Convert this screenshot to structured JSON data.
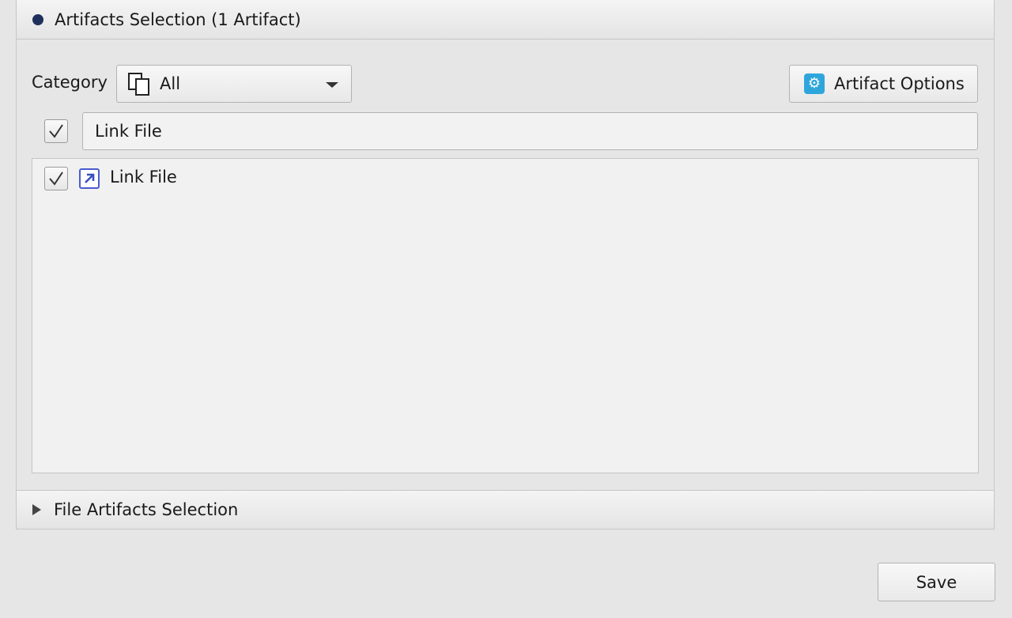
{
  "artifacts_section": {
    "title": "Artifacts Selection (1 Artifact)",
    "expanded": true,
    "category": {
      "label": "Category",
      "selected": "All",
      "icon": "copy-icon"
    },
    "options_button": {
      "label": "Artifact Options",
      "icon": "gear-icon"
    },
    "filter": {
      "checked": true,
      "value": "Link File"
    },
    "items": [
      {
        "label": "Link File",
        "checked": true,
        "icon": "link-file-icon"
      }
    ]
  },
  "file_artifacts_section": {
    "title": "File Artifacts Selection",
    "expanded": false
  },
  "save_button": {
    "label": "Save"
  },
  "colors": {
    "accent_dot": "#1f2f5c",
    "gear_icon": "#2ea6dc",
    "link_icon": "#4a5ccf"
  }
}
